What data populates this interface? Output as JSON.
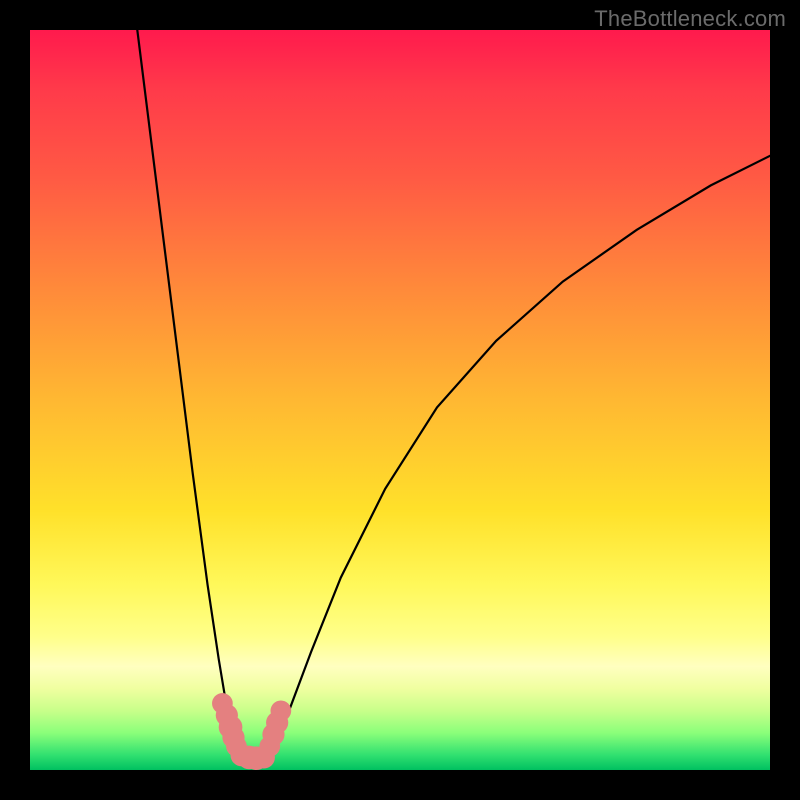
{
  "watermark": "TheBottleneck.com",
  "colors": {
    "frame": "#000000",
    "gradient_top": "#ff1a4d",
    "gradient_bottom": "#00c060",
    "curve": "#000000",
    "bead": "#e48080",
    "watermark": "#6b6b6b"
  },
  "chart_data": {
    "type": "line",
    "title": "",
    "xlabel": "",
    "ylabel": "",
    "xlim": [
      0,
      100
    ],
    "ylim": [
      0,
      100
    ],
    "grid": false,
    "legend": false,
    "series": [
      {
        "name": "left-branch",
        "x": [
          14.5,
          16,
          18,
          20,
          22,
          24,
          25.5,
          26.5,
          27.3,
          27.8,
          28.2,
          28.8
        ],
        "y": [
          100,
          88,
          72,
          56,
          40,
          25,
          15,
          9,
          5.5,
          3.5,
          2.3,
          1.8
        ]
      },
      {
        "name": "right-branch",
        "x": [
          32,
          33,
          35,
          38,
          42,
          48,
          55,
          63,
          72,
          82,
          92,
          100
        ],
        "y": [
          1.8,
          3.5,
          8,
          16,
          26,
          38,
          49,
          58,
          66,
          73,
          79,
          83
        ]
      },
      {
        "name": "floor",
        "x": [
          28.8,
          30,
          31,
          32
        ],
        "y": [
          1.8,
          1.6,
          1.6,
          1.8
        ]
      }
    ],
    "markers": [
      {
        "series": "left-cluster",
        "points": [
          {
            "x": 26.0,
            "y": 9.0,
            "r": 1.4
          },
          {
            "x": 26.6,
            "y": 7.4,
            "r": 1.5
          },
          {
            "x": 27.1,
            "y": 5.8,
            "r": 1.6
          },
          {
            "x": 27.5,
            "y": 4.4,
            "r": 1.5
          },
          {
            "x": 27.9,
            "y": 3.2,
            "r": 1.4
          }
        ]
      },
      {
        "series": "floor-cluster",
        "points": [
          {
            "x": 28.6,
            "y": 2.0,
            "r": 1.5
          },
          {
            "x": 29.6,
            "y": 1.7,
            "r": 1.6
          },
          {
            "x": 30.6,
            "y": 1.6,
            "r": 1.6
          },
          {
            "x": 31.6,
            "y": 1.7,
            "r": 1.5
          }
        ]
      },
      {
        "series": "right-cluster",
        "points": [
          {
            "x": 32.4,
            "y": 3.2,
            "r": 1.4
          },
          {
            "x": 32.9,
            "y": 4.8,
            "r": 1.5
          },
          {
            "x": 33.4,
            "y": 6.4,
            "r": 1.5
          },
          {
            "x": 33.9,
            "y": 8.0,
            "r": 1.4
          }
        ]
      }
    ]
  }
}
